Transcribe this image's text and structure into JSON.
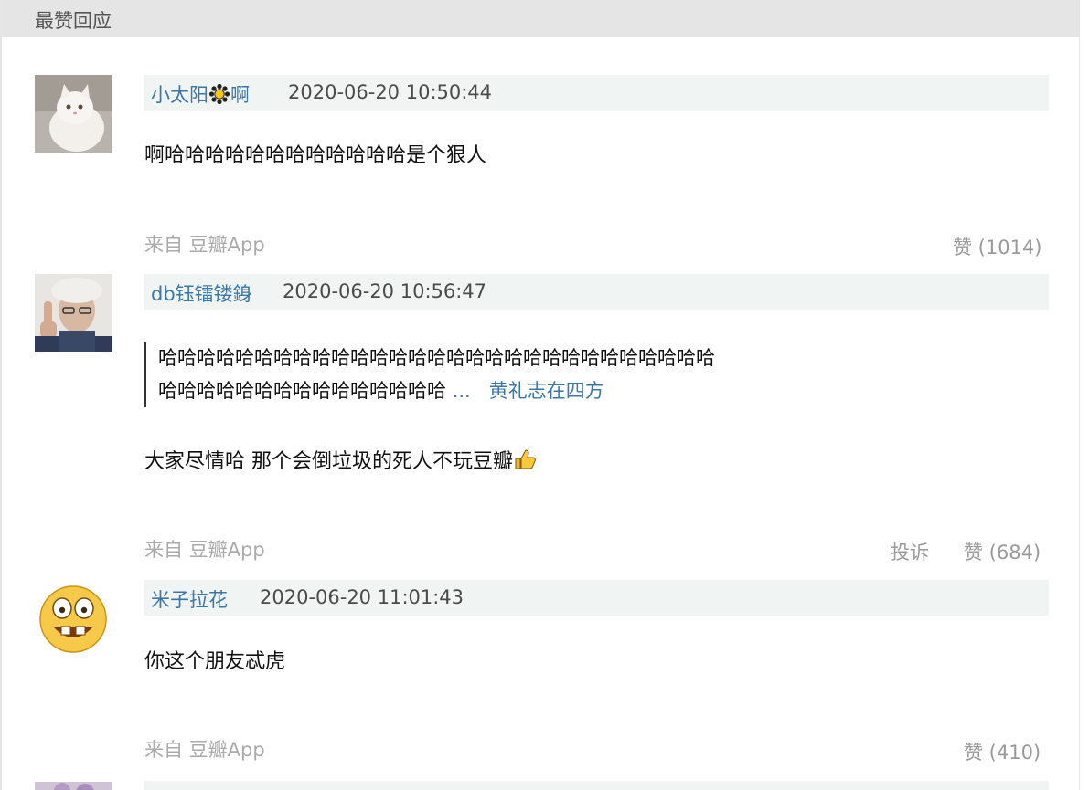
{
  "section": {
    "title": "最赞回应"
  },
  "comments": [
    {
      "author_prefix": "小太阳",
      "author_suffix": "啊",
      "time": "2020-06-20 10:50:44",
      "text": "啊哈哈哈哈哈哈哈哈哈哈哈哈是个狠人",
      "source": "来自 豆瓣App",
      "like_label": "赞 (1014)",
      "avatar_icon": "white-cat-photo"
    },
    {
      "author": "db钰镭镂銵",
      "time": "2020-06-20 10:56:47",
      "quote_line1": "哈哈哈哈哈哈哈哈哈哈哈哈哈哈哈哈哈哈哈哈哈哈哈哈哈哈哈哈哈",
      "quote_line2": "哈哈哈哈哈哈哈哈哈哈哈哈哈哈哈",
      "quote_more": "...",
      "quote_author": "黄礼志在四方",
      "text": "大家尽情哈 那个会倒垃圾的死人不玩豆瓣",
      "source": "来自 豆瓣App",
      "report_label": "投诉",
      "like_label": "赞 (684)",
      "avatar_icon": "old-man-photo"
    },
    {
      "author": "米子拉花",
      "time": "2020-06-20 11:01:43",
      "text": "你这个朋友忒虎",
      "source": "来自 豆瓣App",
      "like_label": "赞 (410)",
      "avatar_icon": "grinning-emoji-face"
    }
  ],
  "colors": {
    "link": "#3a77a8",
    "meta_bg": "#f0f5f3",
    "header_bg": "#e5e5e5",
    "muted": "#aaaaaa"
  }
}
